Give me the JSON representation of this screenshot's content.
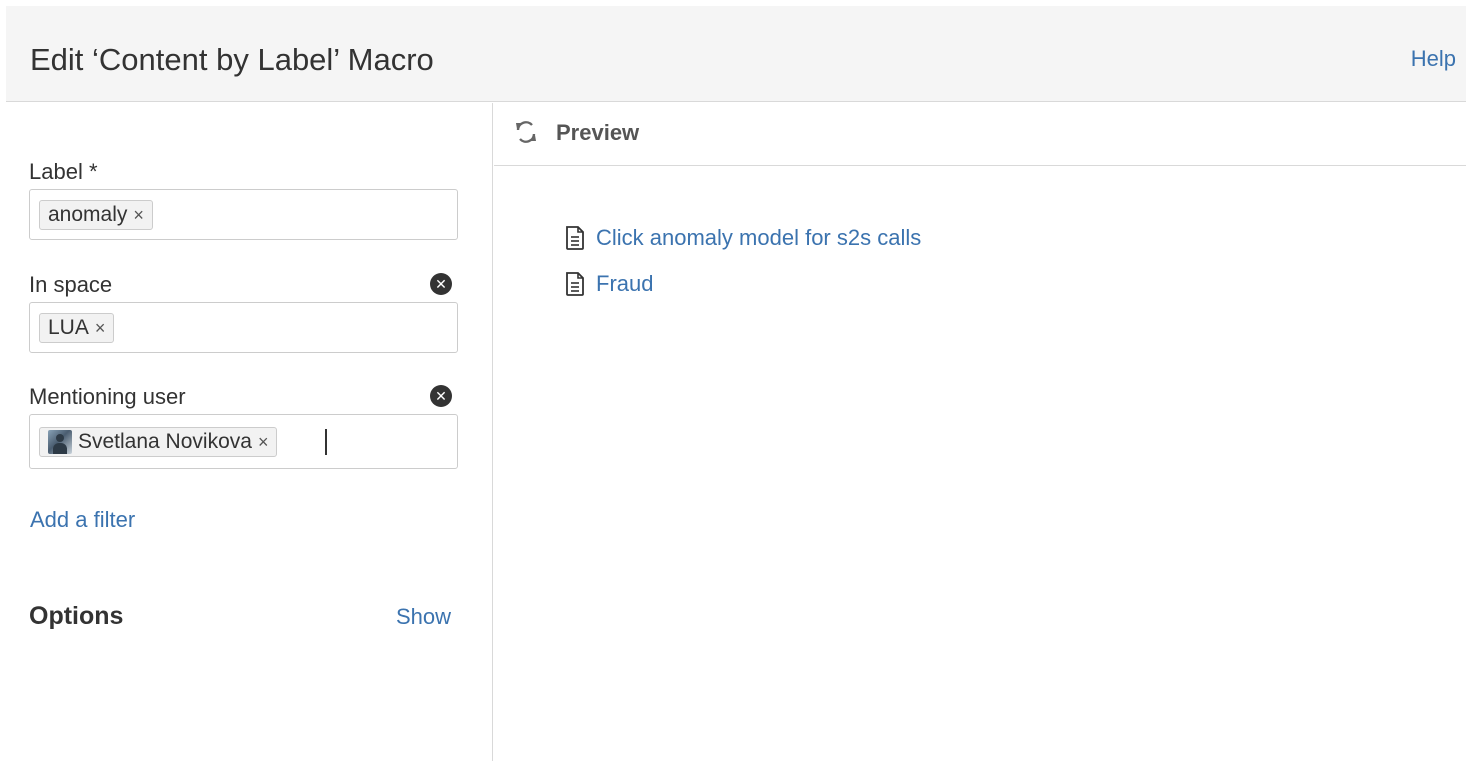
{
  "header": {
    "title": "Edit ‘Content by Label’ Macro",
    "help_label": "Help"
  },
  "filters": {
    "label": {
      "title": "Label *",
      "chips": [
        "anomaly"
      ]
    },
    "space": {
      "title": "In space",
      "chips": [
        "LUA"
      ]
    },
    "user": {
      "title": "Mentioning user",
      "chips": [
        "Svetlana Novikova"
      ]
    },
    "clear_glyph": "✕",
    "remove_glyph": "×",
    "add_filter_label": "Add a filter"
  },
  "options": {
    "title": "Options",
    "toggle_label": "Show"
  },
  "preview": {
    "label": "Preview",
    "results": [
      {
        "title": "Click anomaly model for s2s calls",
        "icon": "page-icon"
      },
      {
        "title": "Fraud",
        "icon": "page-icon"
      }
    ]
  },
  "colors": {
    "link": "#3b73af",
    "header_bg": "#f5f5f5",
    "border": "#cccccc"
  }
}
